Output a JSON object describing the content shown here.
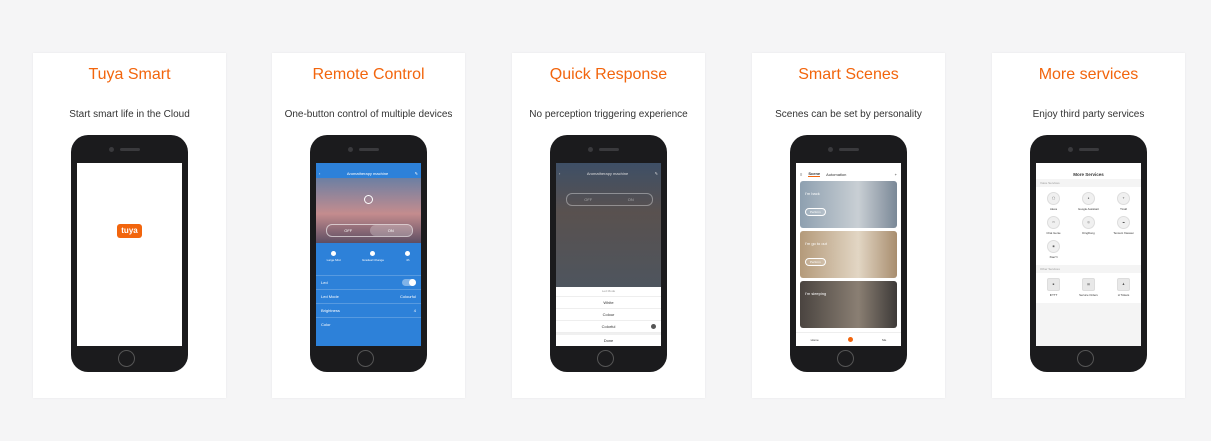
{
  "cards": [
    {
      "title": "Tuya Smart",
      "subtitle": "Start smart life in the Cloud"
    },
    {
      "title": "Remote Control",
      "subtitle": "One-button control of multiple devices"
    },
    {
      "title": "Quick Response",
      "subtitle": "No perception triggering experience"
    },
    {
      "title": "Smart Scenes",
      "subtitle": "Scenes can be set by personality"
    },
    {
      "title": "More services",
      "subtitle": "Enjoy third party services"
    }
  ],
  "colors": {
    "accent": "#f2650d",
    "page_bg": "#f5f5f6",
    "card_bg": "#ffffff",
    "app_blue": "#2d81d9"
  },
  "screen1": {
    "logo": "tuya"
  },
  "screen2": {
    "header": "Aromatherapy machine",
    "off": "OFF",
    "on": "ON",
    "modes": [
      "Large Mist",
      "Gradual Change",
      "4h"
    ],
    "rows": [
      {
        "label": "Led",
        "value": ""
      },
      {
        "label": "Led Mode",
        "value": "Colourful"
      },
      {
        "label": "Brightness",
        "value": "4"
      },
      {
        "label": "Color",
        "value": ""
      }
    ]
  },
  "screen3": {
    "header": "Aromatherapy machine",
    "off": "OFF",
    "on": "ON",
    "sheet_title": "Led Mode",
    "options": [
      "White",
      "Colour",
      "Colorful"
    ],
    "done": "Done"
  },
  "screen4": {
    "tabs": [
      "Scene",
      "Automation"
    ],
    "scenes": [
      {
        "name": "I'm back",
        "button": "Perform"
      },
      {
        "name": "I'm go to out",
        "button": "Perform"
      },
      {
        "name": "I'm sleeping",
        "button": ""
      }
    ],
    "nav": [
      "Home",
      "Smart",
      "Me"
    ]
  },
  "screen5": {
    "header": "More Services",
    "section1": "Voice Services",
    "services": [
      {
        "label": "Alexa",
        "icon": "◯"
      },
      {
        "label": "Google Assistant",
        "icon": "●"
      },
      {
        "label": "Tmall",
        "icon": "T"
      },
      {
        "label": "Chat Genie",
        "icon": "▭"
      },
      {
        "label": "DingDong",
        "icon": "◎"
      },
      {
        "label": "Tencent Xiaowei",
        "icon": "☁"
      },
      {
        "label": "XiaoYi",
        "icon": "◉"
      }
    ],
    "section2": "Other Services",
    "others": [
      {
        "label": "IFTTT",
        "icon": "■"
      },
      {
        "label": "Service Orders",
        "icon": "▤"
      },
      {
        "label": "H Tickets",
        "icon": "♟"
      }
    ]
  }
}
